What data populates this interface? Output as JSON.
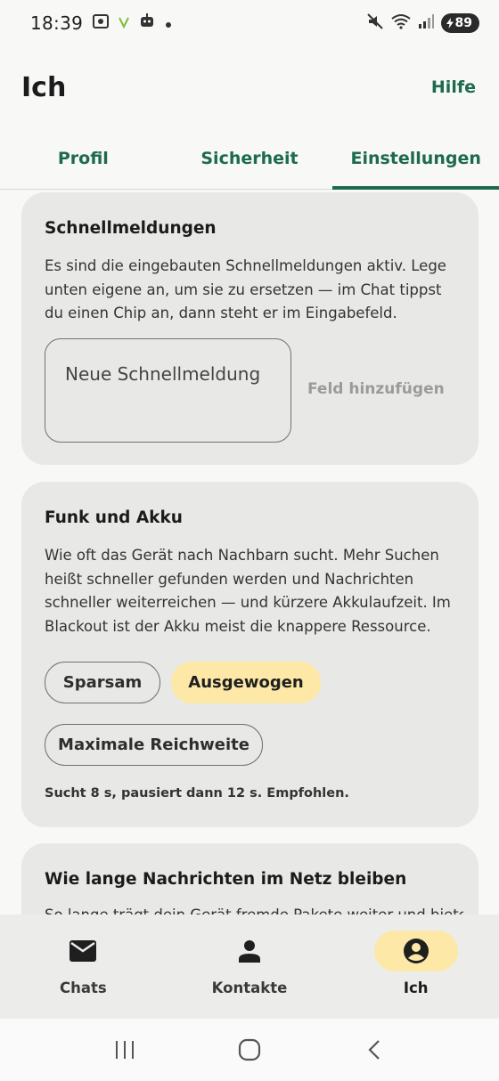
{
  "status_bar": {
    "time": "18:39",
    "battery": "89"
  },
  "header": {
    "title": "Ich",
    "help": "Hilfe"
  },
  "tabs": [
    {
      "label": "Profil"
    },
    {
      "label": "Sicherheit"
    },
    {
      "label": "Einstellungen",
      "active": true
    }
  ],
  "quick_messages": {
    "title": "Schnellmeldungen",
    "description": "Es sind die eingebauten Schnellmeldungen aktiv. Lege unten eigene an, um sie zu ersetzen — im Chat tippst du einen Chip an, dann steht er im Eingabefeld.",
    "input_placeholder": "Neue Schnellmeldung",
    "add_field": "Feld hinzufügen"
  },
  "radio_battery": {
    "title": "Funk und Akku",
    "description": "Wie oft das Gerät nach Nachbarn sucht. Mehr Suchen heißt schneller gefunden werden und Nachrichten schneller weiterreichen — und kürzere Akkulaufzeit. Im Blackout ist der Akku meist die knappere Ressource.",
    "options": [
      {
        "label": "Sparsam",
        "selected": false
      },
      {
        "label": "Ausgewogen",
        "selected": true
      },
      {
        "label": "Maximale Reichweite",
        "selected": false
      }
    ],
    "note": "Sucht 8 s, pausiert dann 12 s. Empfohlen."
  },
  "retention": {
    "title": "Wie lange Nachrichten im Netz bleiben",
    "description": "So lange trägt dein Gerät fremde Pakete weiter und bietet"
  },
  "bottom_nav": [
    {
      "label": "Chats",
      "icon": "mail-icon"
    },
    {
      "label": "Kontakte",
      "icon": "person-icon"
    },
    {
      "label": "Ich",
      "icon": "account-circle-icon",
      "active": true
    }
  ],
  "colors": {
    "accent": "#1d6b4c",
    "chip_selected": "#fde8a7",
    "card_bg": "#e8e9e7"
  }
}
